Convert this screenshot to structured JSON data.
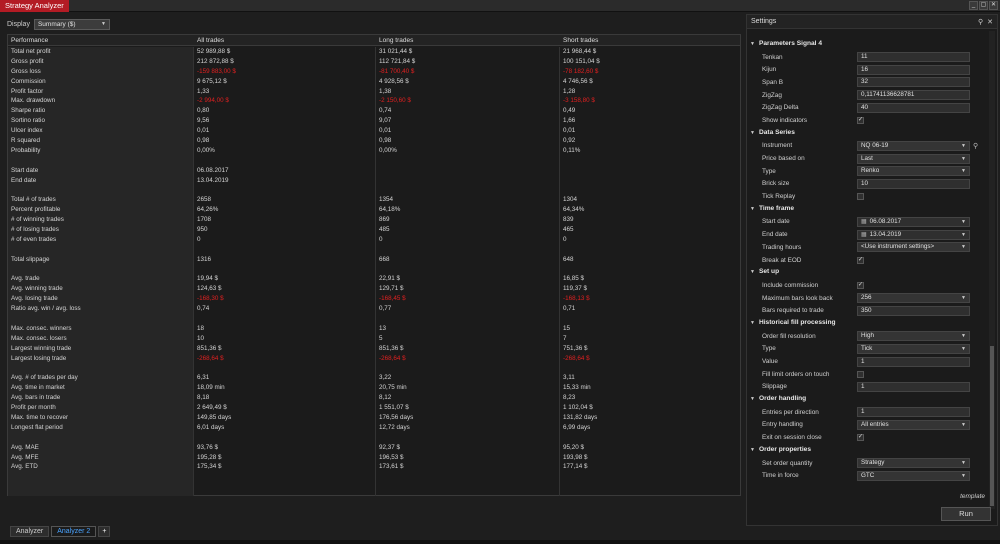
{
  "window": {
    "title": "Strategy Analyzer",
    "buttons": [
      "_",
      "▢",
      "✕"
    ]
  },
  "display": {
    "label": "Display",
    "value": "Summary ($)"
  },
  "grid": {
    "headers": [
      "Performance",
      "All trades",
      "Long trades",
      "Short trades"
    ],
    "rows": [
      {
        "label": "Total net profit",
        "all": "52 989,88 $",
        "long": "31 021,44 $",
        "short": "21 968,44 $"
      },
      {
        "label": "Gross profit",
        "all": "212 872,88 $",
        "long": "112 721,84 $",
        "short": "100 151,04 $"
      },
      {
        "label": "Gross loss",
        "all": "-159 883,00 $",
        "long": "-81 700,40 $",
        "short": "-78 182,60 $",
        "neg": true
      },
      {
        "label": "Commission",
        "all": "9 675,12 $",
        "long": "4 928,56 $",
        "short": "4 746,56 $"
      },
      {
        "label": "Profit factor",
        "all": "1,33",
        "long": "1,38",
        "short": "1,28"
      },
      {
        "label": "Max. drawdown",
        "all": "-2 994,00 $",
        "long": "-2 150,60 $",
        "short": "-3 158,80 $",
        "neg": true
      },
      {
        "label": "Sharpe ratio",
        "all": "0,80",
        "long": "0,74",
        "short": "0,49"
      },
      {
        "label": "Sortino ratio",
        "all": "9,56",
        "long": "9,07",
        "short": "1,66"
      },
      {
        "label": "Ulcer index",
        "all": "0,01",
        "long": "0,01",
        "short": "0,01"
      },
      {
        "label": "R squared",
        "all": "0,98",
        "long": "0,98",
        "short": "0,92"
      },
      {
        "label": "Probability",
        "all": "0,00%",
        "long": "0,00%",
        "short": "0,11%"
      },
      {
        "blank": true
      },
      {
        "label": "Start date",
        "all": "06.08.2017",
        "long": "",
        "short": ""
      },
      {
        "label": "End date",
        "all": "13.04.2019",
        "long": "",
        "short": ""
      },
      {
        "blank": true
      },
      {
        "label": "Total # of trades",
        "all": "2658",
        "long": "1354",
        "short": "1304"
      },
      {
        "label": "Percent profitable",
        "all": "64,26%",
        "long": "64,18%",
        "short": "64,34%"
      },
      {
        "label": "# of winning trades",
        "all": "1708",
        "long": "869",
        "short": "839"
      },
      {
        "label": "# of losing trades",
        "all": "950",
        "long": "485",
        "short": "465"
      },
      {
        "label": "# of even trades",
        "all": "0",
        "long": "0",
        "short": "0"
      },
      {
        "blank": true
      },
      {
        "label": "Total slippage",
        "all": "1316",
        "long": "668",
        "short": "648"
      },
      {
        "blank": true
      },
      {
        "label": "Avg. trade",
        "all": "19,94 $",
        "long": "22,91 $",
        "short": "16,85 $"
      },
      {
        "label": "Avg. winning trade",
        "all": "124,63 $",
        "long": "129,71 $",
        "short": "119,37 $"
      },
      {
        "label": "Avg. losing trade",
        "all": "-168,30 $",
        "long": "-168,45 $",
        "short": "-168,13 $",
        "neg": true
      },
      {
        "label": "Ratio avg. win / avg. loss",
        "all": "0,74",
        "long": "0,77",
        "short": "0,71"
      },
      {
        "blank": true
      },
      {
        "label": "Max. consec. winners",
        "all": "18",
        "long": "13",
        "short": "15"
      },
      {
        "label": "Max. consec. losers",
        "all": "10",
        "long": "5",
        "short": "7"
      },
      {
        "label": "Largest winning trade",
        "all": "851,36 $",
        "long": "851,36 $",
        "short": "751,36 $"
      },
      {
        "label": "Largest losing trade",
        "all": "-268,64 $",
        "long": "-268,64 $",
        "short": "-268,64 $",
        "neg": true
      },
      {
        "blank": true
      },
      {
        "label": "Avg. # of trades per day",
        "all": "6,31",
        "long": "3,22",
        "short": "3,11"
      },
      {
        "label": "Avg. time in market",
        "all": "18,09 min",
        "long": "20,75 min",
        "short": "15,33 min"
      },
      {
        "label": "Avg. bars in trade",
        "all": "8,18",
        "long": "8,12",
        "short": "8,23"
      },
      {
        "label": "Profit per month",
        "all": "2 649,49 $",
        "long": "1 551,07 $",
        "short": "1 102,04 $"
      },
      {
        "label": "Max. time to recover",
        "all": "149,85 days",
        "long": "176,56 days",
        "short": "131,82 days"
      },
      {
        "label": "Longest flat period",
        "all": "6,01 days",
        "long": "12,72 days",
        "short": "6,99 days"
      },
      {
        "blank": true
      },
      {
        "label": "Avg. MAE",
        "all": "93,76 $",
        "long": "92,37 $",
        "short": "95,20 $"
      },
      {
        "label": "Avg. MFE",
        "all": "195,28 $",
        "long": "196,53 $",
        "short": "193,98 $"
      },
      {
        "label": "Avg. ETD",
        "all": "175,34 $",
        "long": "173,61 $",
        "short": "177,14 $"
      }
    ]
  },
  "tabs": [
    {
      "label": "Analyzer",
      "active": false
    },
    {
      "label": "Analyzer 2",
      "active": true
    },
    {
      "label": "+",
      "active": false
    }
  ],
  "settings": {
    "title": "Settings",
    "pin_icon": "pin-icon",
    "close_icon": "close-icon",
    "template_label": "template",
    "run_label": "Run",
    "sections": [
      {
        "title": "Parameters Signal 4",
        "rows": [
          {
            "label": "Tenkan",
            "value": "11",
            "kind": "input"
          },
          {
            "label": "Kijun",
            "value": "16",
            "kind": "input"
          },
          {
            "label": "Span B",
            "value": "32",
            "kind": "input"
          },
          {
            "label": "ZigZag",
            "value": "0,11741136628781",
            "kind": "input"
          },
          {
            "label": "ZigZag Delta",
            "value": "40",
            "kind": "input"
          },
          {
            "label": "Show indicators",
            "value": "✓",
            "kind": "check"
          }
        ]
      },
      {
        "title": "Data Series",
        "rows": [
          {
            "label": "Instrument",
            "value": "NQ 06-19",
            "kind": "dropdown-search"
          },
          {
            "label": "Price based on",
            "value": "Last",
            "kind": "dropdown"
          },
          {
            "label": "Type",
            "value": "Renko",
            "kind": "dropdown"
          },
          {
            "label": "Brick size",
            "value": "10",
            "kind": "input"
          },
          {
            "label": "Tick Replay",
            "value": "",
            "kind": "check"
          }
        ]
      },
      {
        "title": "Time frame",
        "rows": [
          {
            "label": "Start date",
            "value": "06.08.2017",
            "kind": "date"
          },
          {
            "label": "End date",
            "value": "13.04.2019",
            "kind": "date"
          },
          {
            "label": "Trading hours",
            "value": "<Use instrument settings>",
            "kind": "dropdown"
          },
          {
            "label": "Break at EOD",
            "value": "✓",
            "kind": "check"
          }
        ]
      },
      {
        "title": "Set up",
        "rows": [
          {
            "label": "Include commission",
            "value": "✓",
            "kind": "check"
          },
          {
            "label": "Maximum bars look back",
            "value": "256",
            "kind": "dropdown"
          },
          {
            "label": "Bars required to trade",
            "value": "350",
            "kind": "input"
          }
        ]
      },
      {
        "title": "Historical fill processing",
        "rows": [
          {
            "label": "Order fill resolution",
            "value": "High",
            "kind": "dropdown"
          },
          {
            "label": "Type",
            "value": "Tick",
            "kind": "dropdown"
          },
          {
            "label": "Value",
            "value": "1",
            "kind": "input"
          },
          {
            "label": "Fill limit orders on touch",
            "value": "",
            "kind": "check"
          },
          {
            "label": "Slippage",
            "value": "1",
            "kind": "input"
          }
        ]
      },
      {
        "title": "Order handling",
        "rows": [
          {
            "label": "Entries per direction",
            "value": "1",
            "kind": "input"
          },
          {
            "label": "Entry handling",
            "value": "All entries",
            "kind": "dropdown"
          },
          {
            "label": "Exit on session close",
            "value": "✓",
            "kind": "check"
          }
        ]
      },
      {
        "title": "Order properties",
        "rows": [
          {
            "label": "Set order quantity",
            "value": "Strategy",
            "kind": "dropdown"
          },
          {
            "label": "Time in force",
            "value": "GTC",
            "kind": "dropdown"
          }
        ]
      }
    ]
  }
}
